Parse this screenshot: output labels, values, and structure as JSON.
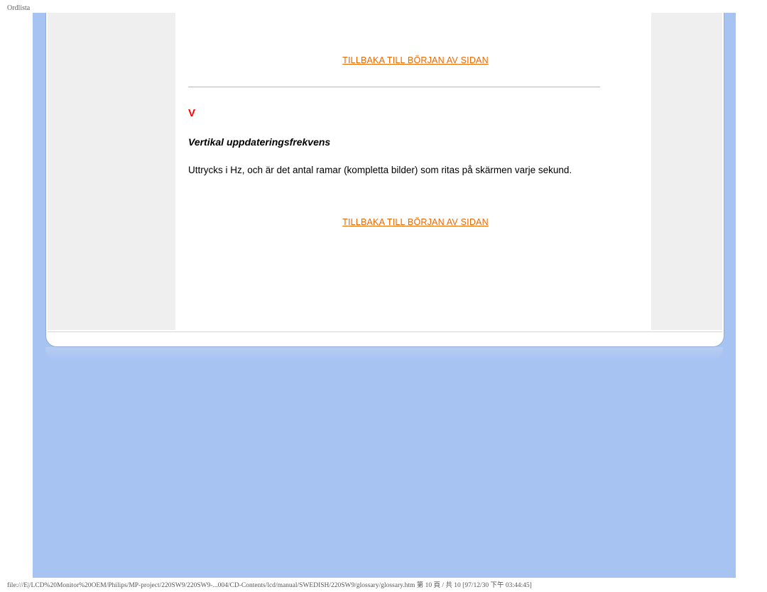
{
  "header": {
    "label": "Ordlista"
  },
  "links": {
    "back_to_top": "TILLBAKA TILL BÖRJAN AV SIDAN"
  },
  "section": {
    "letter": "V",
    "term": "Vertikal uppdateringsfrekvens",
    "definition": "Uttrycks i Hz, och är det antal ramar (kompletta bilder) som ritas på skärmen varje sekund."
  },
  "footer": {
    "path": "file:///E|/LCD%20Monitor%20OEM/Philips/MP-project/220SW9/220SW9-...004/CD-Contents/lcd/manual/SWEDISH/220SW9/glossary/glossary.htm 第 10 頁 / 共 10  [97/12/30 下午 03:44:45]"
  }
}
